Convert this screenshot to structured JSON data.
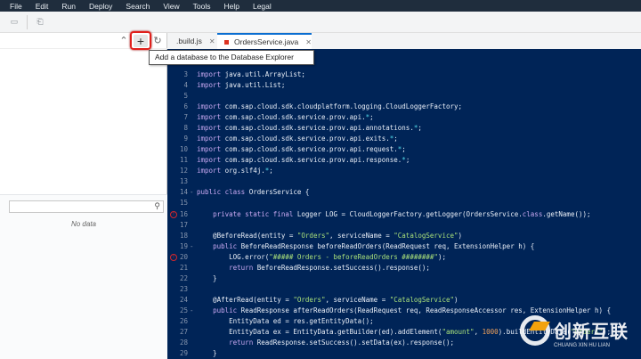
{
  "menu": [
    "File",
    "Edit",
    "Run",
    "Deploy",
    "Search",
    "View",
    "Tools",
    "Help",
    "Legal"
  ],
  "left_panel": {
    "search": {
      "value": "",
      "placeholder": ""
    },
    "empty_text": "No data"
  },
  "tabs": [
    {
      "label": ".build.js",
      "active": false
    },
    {
      "label": "OrdersService.java",
      "active": true,
      "modified": true
    }
  ],
  "tooltip": "Add a database to the Database Explorer",
  "watermark": {
    "text": "创新互联",
    "subtext": "CHUANG XIN HU LIAN"
  },
  "colors": {
    "editor_bg": "#002457",
    "highlight": "#e0201c",
    "keyword": "#c9a9f2",
    "string": "#a8e07a"
  },
  "editor": {
    "lines": [
      {
        "n": "3",
        "t": [
          [
            "kw",
            "import"
          ],
          [
            "",
            "java.util.ArrayList;"
          ]
        ]
      },
      {
        "n": "4",
        "t": [
          [
            "kw",
            "import"
          ],
          [
            "",
            "java.util.List;"
          ]
        ]
      },
      {
        "n": "5",
        "t": []
      },
      {
        "n": "6",
        "t": [
          [
            "kw",
            "import"
          ],
          [
            "",
            "com.sap.cloud.sdk.cloudplatform.logging.CloudLoggerFactory;"
          ]
        ]
      },
      {
        "n": "7",
        "t": [
          [
            "kw",
            "import"
          ],
          [
            "",
            "com.sap.cloud.sdk.service.prov.api."
          ],
          [
            "op",
            "*"
          ],
          [
            "",
            ";"
          ]
        ]
      },
      {
        "n": "8",
        "t": [
          [
            "kw",
            "import"
          ],
          [
            "",
            "com.sap.cloud.sdk.service.prov.api.annotations."
          ],
          [
            "op",
            "*"
          ],
          [
            "",
            ";"
          ]
        ]
      },
      {
        "n": "9",
        "t": [
          [
            "kw",
            "import"
          ],
          [
            "",
            "com.sap.cloud.sdk.service.prov.api.exits."
          ],
          [
            "op",
            "*"
          ],
          [
            "",
            ";"
          ]
        ]
      },
      {
        "n": "10",
        "t": [
          [
            "kw",
            "import"
          ],
          [
            "",
            "com.sap.cloud.sdk.service.prov.api.request."
          ],
          [
            "op",
            "*"
          ],
          [
            "",
            ";"
          ]
        ]
      },
      {
        "n": "11",
        "t": [
          [
            "kw",
            "import"
          ],
          [
            "",
            "com.sap.cloud.sdk.service.prov.api.response."
          ],
          [
            "op",
            "*"
          ],
          [
            "",
            ";"
          ]
        ]
      },
      {
        "n": "12",
        "t": [
          [
            "kw",
            "import"
          ],
          [
            "",
            "org.slf4j."
          ],
          [
            "op",
            "*"
          ],
          [
            "",
            ";"
          ]
        ]
      },
      {
        "n": "13",
        "t": []
      },
      {
        "n": "14",
        "fold": true,
        "t": [
          [
            "kw",
            "public class"
          ],
          [
            "",
            "OrdersService {"
          ]
        ]
      },
      {
        "n": "15",
        "t": []
      },
      {
        "n": "16",
        "error": true,
        "t": [
          [
            "",
            "    "
          ],
          [
            "kw",
            "private static final"
          ],
          [
            "",
            "Logger LOG = CloudLoggerFactory.getLogger(OrdersService."
          ],
          [
            "kw",
            "class"
          ],
          [
            "",
            ".getName());"
          ]
        ]
      },
      {
        "n": "17",
        "t": []
      },
      {
        "n": "18",
        "t": [
          [
            "",
            "    @BeforeRead(entity = "
          ],
          [
            "str",
            "\"Orders\""
          ],
          [
            "",
            ", serviceName = "
          ],
          [
            "str",
            "\"CatalogService\""
          ],
          [
            "",
            ")"
          ]
        ]
      },
      {
        "n": "19",
        "fold": true,
        "t": [
          [
            "",
            "    "
          ],
          [
            "kw",
            "public"
          ],
          [
            "",
            "BeforeReadResponse beforeReadOrders(ReadRequest req, ExtensionHelper h) {"
          ]
        ]
      },
      {
        "n": "20",
        "error": true,
        "t": [
          [
            "",
            "        LOG.error("
          ],
          [
            "str",
            "\"##### Orders - beforeReadOrders ########\""
          ],
          [
            "",
            ");"
          ]
        ]
      },
      {
        "n": "21",
        "t": [
          [
            "",
            "        "
          ],
          [
            "kw",
            "return"
          ],
          [
            "",
            "BeforeReadResponse.setSuccess().response();"
          ]
        ]
      },
      {
        "n": "22",
        "t": [
          [
            "",
            "    }"
          ]
        ]
      },
      {
        "n": "23",
        "t": []
      },
      {
        "n": "24",
        "t": [
          [
            "",
            "    @AfterRead(entity = "
          ],
          [
            "str",
            "\"Orders\""
          ],
          [
            "",
            ", serviceName = "
          ],
          [
            "str",
            "\"CatalogService\""
          ],
          [
            "",
            ")"
          ]
        ]
      },
      {
        "n": "25",
        "fold": true,
        "t": [
          [
            "",
            "    "
          ],
          [
            "kw",
            "public"
          ],
          [
            "",
            "ReadResponse afterReadOrders(ReadRequest req, ReadResponseAccessor res, ExtensionHelper h) {"
          ]
        ]
      },
      {
        "n": "26",
        "t": [
          [
            "",
            "        EntityData ed = res.getEntityData();"
          ]
        ]
      },
      {
        "n": "27",
        "t": [
          [
            "",
            "        EntityData ex = EntityData.getBuilder(ed).addElement("
          ],
          [
            "str",
            "\"amount\""
          ],
          [
            "",
            ", "
          ],
          [
            "num",
            "1000"
          ],
          [
            "",
            ").buildEntityData("
          ],
          [
            "str",
            "\"Orders\""
          ],
          [
            "",
            ");"
          ]
        ]
      },
      {
        "n": "28",
        "t": [
          [
            "",
            "        "
          ],
          [
            "kw",
            "return"
          ],
          [
            "",
            "ReadResponse.setSuccess().setData(ex).response();"
          ]
        ]
      },
      {
        "n": "29",
        "t": [
          [
            "",
            "    }"
          ]
        ]
      }
    ]
  }
}
